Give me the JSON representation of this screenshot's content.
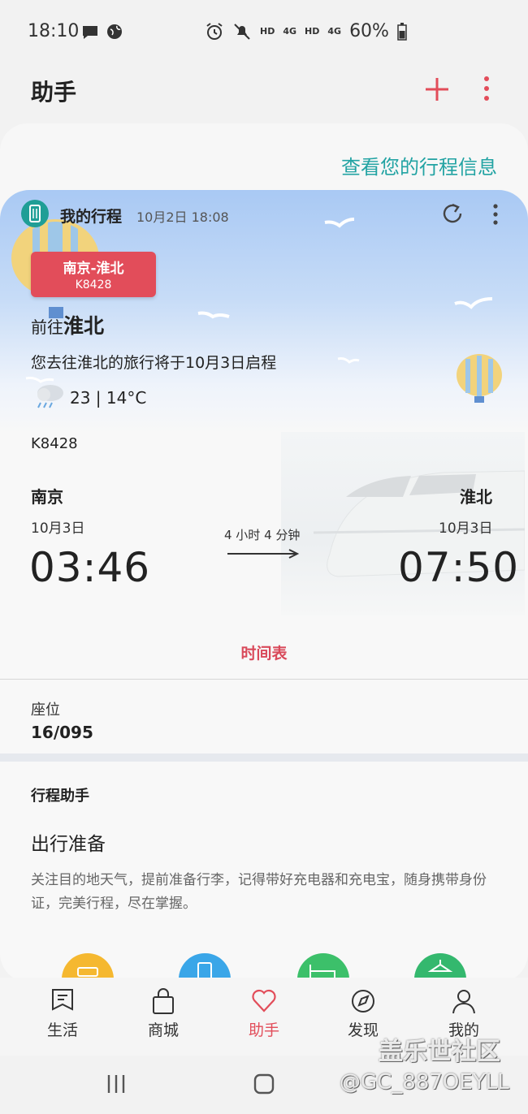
{
  "status": {
    "time": "18:10",
    "network_a": "HD",
    "network_b": "4G",
    "network_c": "HD",
    "network_d": "4G",
    "battery": "60%"
  },
  "header": {
    "title": "助手"
  },
  "itinerary_link": "查看您的行程信息",
  "card": {
    "title": "我的行程",
    "timestamp": "10月2日 18:08",
    "badge_route": "南京-淮北",
    "badge_train": "K8428",
    "dest_prefix": "前往",
    "dest_city": "淮北",
    "description": "您去往淮北的旅行将于10月3日启程",
    "weather": "23 | 14°C",
    "train_number": "K8428",
    "from_city": "南京",
    "to_city": "淮北",
    "from_date": "10月3日",
    "to_date": "10月3日",
    "depart_time": "03:46",
    "arrive_time": "07:50",
    "duration": "4 小时 4 分钟",
    "timetable": "时间表",
    "seat_label": "座位",
    "seat_value": "16/095"
  },
  "assistant": {
    "title": "行程助手",
    "prep_title": "出行准备",
    "prep_desc": "关注目的地天气，提前准备行李，记得带好充电器和充电宝，随身携带身份证，完美行程，尽在掌握。"
  },
  "shortcuts": [
    {
      "icon": "taxi-icon",
      "color": "#f5b830"
    },
    {
      "icon": "card-icon",
      "color": "#3aa6e8"
    },
    {
      "icon": "hotel-icon",
      "color": "#3cc06a"
    },
    {
      "icon": "attraction-icon",
      "color": "#34b86e"
    }
  ],
  "nav": [
    {
      "label": "生活",
      "icon": "life-icon"
    },
    {
      "label": "商城",
      "icon": "mall-icon"
    },
    {
      "label": "助手",
      "icon": "heart-icon"
    },
    {
      "label": "发现",
      "icon": "compass-icon"
    },
    {
      "label": "我的",
      "icon": "profile-icon"
    }
  ],
  "watermark": {
    "line1": "盖乐世社区",
    "line2": "@GC_887OEYLL"
  },
  "colors": {
    "accent": "#e24d5a",
    "teal": "#22a3a3"
  }
}
